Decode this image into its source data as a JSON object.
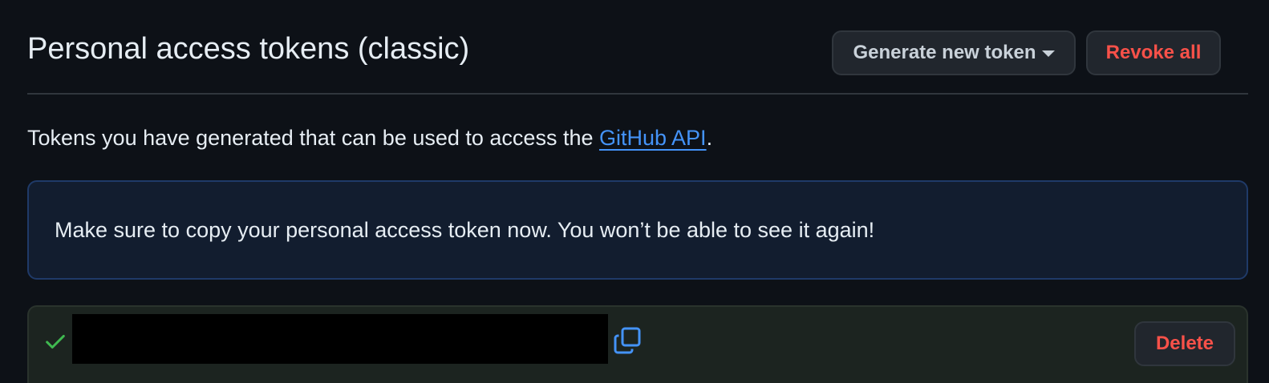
{
  "header": {
    "title": "Personal access tokens (classic)",
    "generate_button_label": "Generate new token",
    "revoke_button_label": "Revoke all"
  },
  "description": {
    "text_before_link": "Tokens you have generated that can be used to access the ",
    "link_text": "GitHub API",
    "text_after_link": "."
  },
  "flash": {
    "message": "Make sure to copy your personal access token now. You won’t be able to see it again!"
  },
  "token_row": {
    "token_value": "",
    "delete_button_label": "Delete",
    "status_icon": "check-icon",
    "copy_icon": "copy-icon"
  },
  "colors": {
    "background": "#0d1117",
    "danger": "#f85149",
    "link": "#4493f8",
    "success": "#3fb950",
    "flash_background": "#121d2f",
    "flash_border": "#1f3a68",
    "token_row_background": "#1c2420"
  }
}
